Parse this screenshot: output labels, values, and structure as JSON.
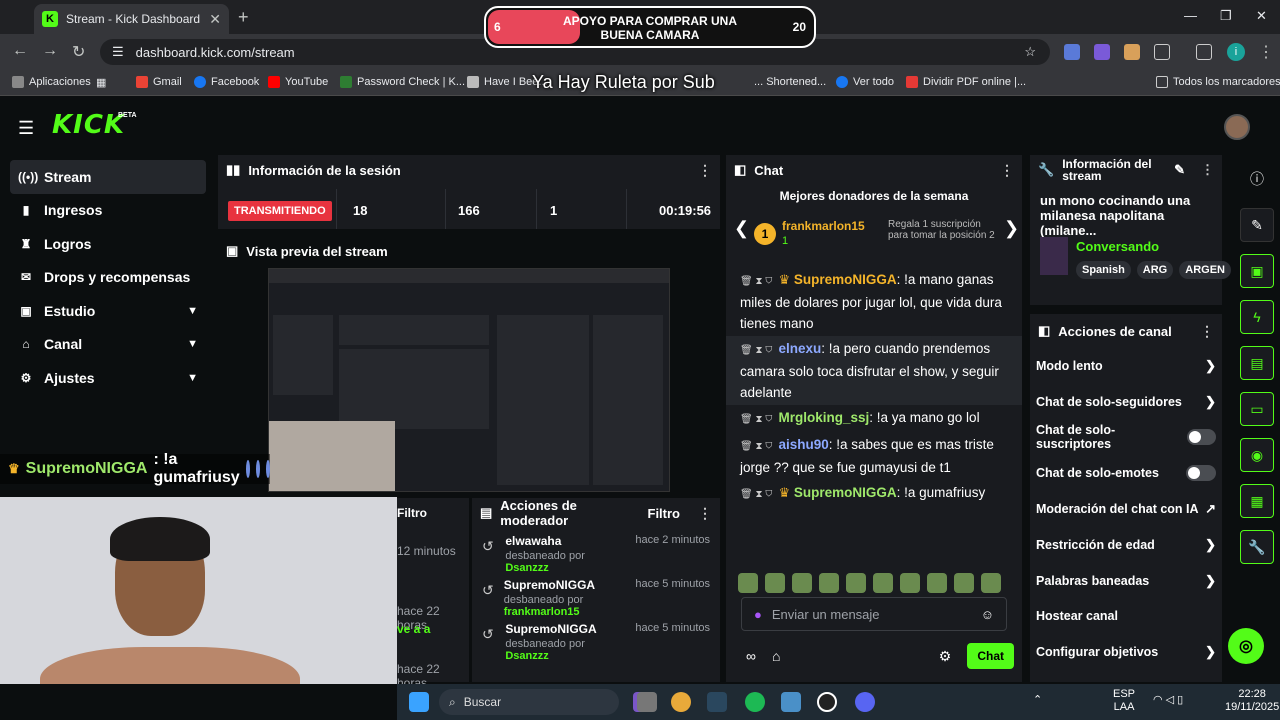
{
  "browser": {
    "tab_title": "Stream - Kick Dashboard",
    "url": "dashboard.kick.com/stream",
    "bookmarks": [
      "Aplicaciones",
      "Gmail",
      "Facebook",
      "YouTube",
      "Password Check | K...",
      "Have I Bee...",
      "... Shortened...",
      "Ver todo",
      "Dividir PDF online |...",
      "Todos los marcadores"
    ]
  },
  "overlay": {
    "goal_start": "6",
    "goal_text": "APOYO PARA COMPRAR UNA BUENA CAMARA",
    "goal_end": "20",
    "goal_progress": 0.28,
    "ruleta": "Ya Hay Ruleta por Sub",
    "chat_user": "SupremoNIGGA",
    "chat_text": ": !a gumafriusy"
  },
  "header": {
    "logo": "KICK",
    "beta": "BETA"
  },
  "sidebar": {
    "items": [
      {
        "label": "Stream",
        "icon": "stream-icon"
      },
      {
        "label": "Ingresos",
        "icon": "income-icon"
      },
      {
        "label": "Logros",
        "icon": "trophy-icon"
      },
      {
        "label": "Drops y recompensas",
        "icon": "gift-icon"
      },
      {
        "label": "Estudio",
        "icon": "studio-icon"
      },
      {
        "label": "Canal",
        "icon": "channel-icon"
      },
      {
        "label": "Ajustes",
        "icon": "gear-icon"
      }
    ]
  },
  "session": {
    "title": "Información de la sesión",
    "status": "TRANSMITIENDO",
    "stat1": "18",
    "stat2": "166",
    "stat3": "1",
    "duration": "00:19:56"
  },
  "preview": {
    "title": "Vista previa del stream"
  },
  "mod": {
    "title": "Acciones de moderador",
    "filter": "Filtro",
    "rows": [
      {
        "user": "elwawaha",
        "action": "desbaneado por",
        "by": "Dsanzzz",
        "time": "hace 2 minutos"
      },
      {
        "user": "SupremoNIGGA",
        "action": "desbaneado por",
        "by": "frankmarlon15",
        "time": "hace 5 minutos"
      },
      {
        "user": "SupremoNIGGA",
        "action": "desbaneado por",
        "by": "Dsanzzz",
        "time": "hace 5 minutos"
      }
    ],
    "stub_filter": "Filtro",
    "stub_t1": "12 minutos",
    "stub_t2": "hace 22 horas",
    "stub_t3": "ve a a",
    "stub_t4": "hace 22 horas"
  },
  "chat": {
    "title": "Chat",
    "donors_title": "Mejores donadores de la semana",
    "donor_rank": "1",
    "donor_name": "frankmarlon15",
    "donor_count": "1",
    "donor_hint": "Regala 1 suscripción para tomar la posición 2",
    "messages": [
      {
        "user": "SupremoNIGGA",
        "text": ": !a mano ganas miles de dolares por jugar lol, que vida dura tienes mano"
      },
      {
        "user": "elnexu",
        "text": ": !a pero cuando prendemos camara solo toca disfrutar el show, y seguir adelante"
      },
      {
        "user": "Mrgloking_ssj",
        "text": ": !a ya mano go lol"
      },
      {
        "user": "aishu90",
        "text": ": !a sabes que es mas triste jorge ?? que se fue gumayusi de t1"
      },
      {
        "user": "SupremoNIGGA",
        "text": ": !a gumafriusy"
      }
    ],
    "placeholder": "Enviar un mensaje",
    "send": "Chat"
  },
  "info": {
    "title": "Información del stream",
    "stream_title": "un mono cocinando una milanesa napolitana (milane...",
    "category": "Conversando",
    "tags": [
      "Spanish",
      "ARG",
      "ARGEN"
    ]
  },
  "actions": {
    "title": "Acciones de canal",
    "items": [
      {
        "label": "Modo lento",
        "kind": "chev"
      },
      {
        "label": "Chat de solo-seguidores",
        "kind": "chev"
      },
      {
        "label": "Chat de solo-suscriptores",
        "kind": "toggle"
      },
      {
        "label": "Chat de solo-emotes",
        "kind": "toggle"
      },
      {
        "label": "Moderación del chat con IA",
        "kind": "ext"
      },
      {
        "label": "Restricción de edad",
        "kind": "chev"
      },
      {
        "label": "Palabras baneadas",
        "kind": "chev"
      },
      {
        "label": "Hostear canal",
        "kind": "none"
      },
      {
        "label": "Configurar objetivos",
        "kind": "chev"
      }
    ]
  },
  "taskbar": {
    "search": "Buscar",
    "lang1": "ESP",
    "lang2": "LAA",
    "time": "22:28",
    "date": "19/11/2025"
  },
  "colors": {
    "accent": "#53fc18",
    "live": "#e8333f",
    "gold": "#f4b42a"
  }
}
